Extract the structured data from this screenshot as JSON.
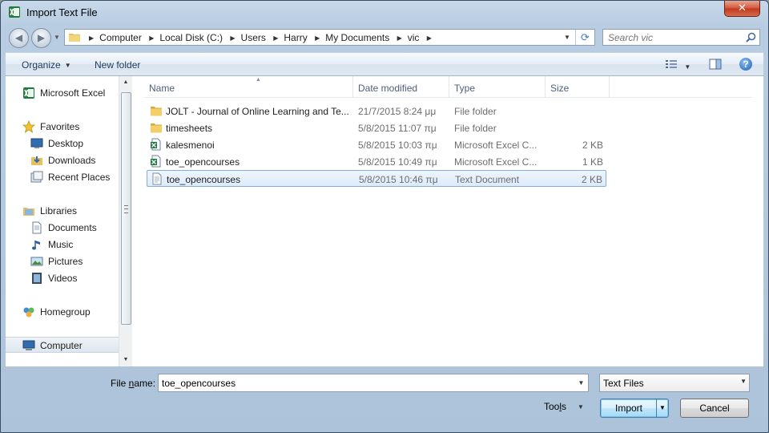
{
  "window": {
    "title": "Import Text File",
    "close_glyph": "✕"
  },
  "nav": {
    "back_glyph": "◀",
    "forward_glyph": "▶",
    "breadcrumbs": [
      "Computer",
      "Local Disk (C:)",
      "Users",
      "Harry",
      "My Documents",
      "vic"
    ],
    "search_placeholder": "Search vic"
  },
  "toolbar": {
    "organize_label": "Organize",
    "new_folder_label": "New folder",
    "help_glyph": "?"
  },
  "sidebar": {
    "items": [
      {
        "label": "Microsoft Excel",
        "icon": "excel-icon"
      },
      {
        "label": "Favorites",
        "icon": "star-icon"
      },
      {
        "label": "Desktop",
        "icon": "desktop-icon"
      },
      {
        "label": "Downloads",
        "icon": "downloads-icon"
      },
      {
        "label": "Recent Places",
        "icon": "recent-places-icon"
      },
      {
        "label": "Libraries",
        "icon": "libraries-icon"
      },
      {
        "label": "Documents",
        "icon": "documents-icon"
      },
      {
        "label": "Music",
        "icon": "music-icon"
      },
      {
        "label": "Pictures",
        "icon": "pictures-icon"
      },
      {
        "label": "Videos",
        "icon": "videos-icon"
      },
      {
        "label": "Homegroup",
        "icon": "homegroup-icon"
      },
      {
        "label": "Computer",
        "icon": "computer-icon"
      }
    ],
    "selected": "Computer"
  },
  "files": {
    "columns": {
      "name": "Name",
      "date": "Date modified",
      "type": "Type",
      "size": "Size"
    },
    "rows": [
      {
        "name": "JOLT - Journal of Online Learning and Te...",
        "date": "21/7/2015 8:24 μμ",
        "type": "File folder",
        "size": "",
        "icon": "folder-icon"
      },
      {
        "name": "timesheets",
        "date": "5/8/2015 11:07 πμ",
        "type": "File folder",
        "size": "",
        "icon": "folder-icon"
      },
      {
        "name": "kalesmenoi",
        "date": "5/8/2015 10:03 πμ",
        "type": "Microsoft Excel C...",
        "size": "2 KB",
        "icon": "excel-csv-icon"
      },
      {
        "name": "toe_opencourses",
        "date": "5/8/2015 10:49 πμ",
        "type": "Microsoft Excel C...",
        "size": "1 KB",
        "icon": "excel-csv-icon"
      },
      {
        "name": "toe_opencourses",
        "date": "5/8/2015 10:46 πμ",
        "type": "Text Document",
        "size": "2 KB",
        "icon": "text-document-icon"
      }
    ],
    "selected_index": 4
  },
  "footer": {
    "file_name_label_pre": "File ",
    "file_name_label_u": "n",
    "file_name_label_post": "ame:",
    "file_name_value": "toe_opencourses",
    "file_type_value": "Text Files",
    "tools_label_pre": "Too",
    "tools_label_u": "l",
    "tools_label_post": "s",
    "import_label": "Import",
    "cancel_label": "Cancel"
  },
  "colors": {
    "selection_border": "#84acdd",
    "selection_fill": "#dcebfc",
    "accent": "#3c7fb1"
  }
}
